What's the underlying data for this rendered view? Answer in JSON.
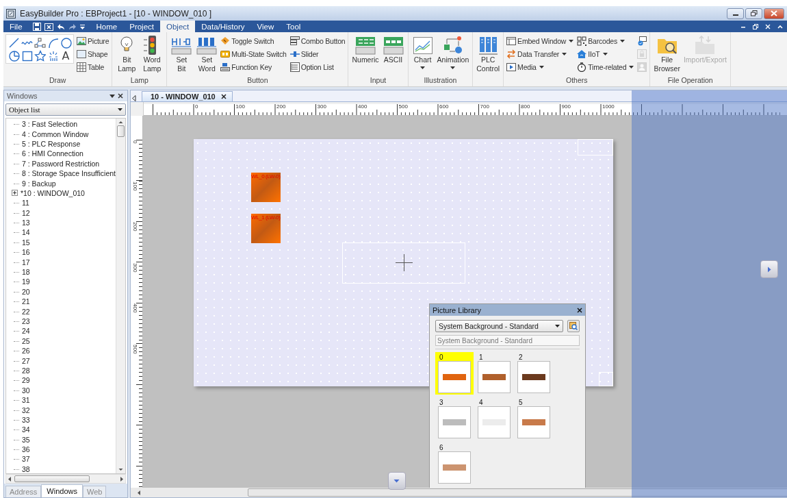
{
  "window": {
    "title": "EasyBuilder Pro : EBProject1 - [10 - WINDOW_010 ]"
  },
  "menu": {
    "file": "File",
    "tabs": [
      {
        "label": "Home",
        "selected": false
      },
      {
        "label": "Project",
        "selected": false
      },
      {
        "label": "Object",
        "selected": true
      },
      {
        "label": "Data/History",
        "selected": false
      },
      {
        "label": "View",
        "selected": false
      },
      {
        "label": "Tool",
        "selected": false
      }
    ]
  },
  "ribbon": {
    "groups": [
      {
        "label": "Draw",
        "items": [
          {
            "kind": "palette",
            "text_tool": "A"
          },
          {
            "kind": "small",
            "label": "Picture",
            "dropdown": false,
            "disabled": false
          },
          {
            "kind": "small",
            "label": "Shape",
            "dropdown": false,
            "disabled": false
          },
          {
            "kind": "small",
            "label": "Table",
            "dropdown": false,
            "disabled": false
          }
        ]
      },
      {
        "label": "Lamp",
        "items": [
          {
            "kind": "large",
            "label": "Bit Lamp",
            "dropdown": false,
            "disabled": false
          },
          {
            "kind": "large",
            "label": "Word Lamp",
            "dropdown": false,
            "disabled": false
          }
        ]
      },
      {
        "label": "Button",
        "items": [
          {
            "kind": "large",
            "label": "Set Bit",
            "dropdown": false,
            "disabled": false
          },
          {
            "kind": "large",
            "label": "Set Word",
            "dropdown": false,
            "disabled": false
          },
          {
            "kind": "small",
            "label": "Toggle Switch",
            "dropdown": false,
            "disabled": false
          },
          {
            "kind": "small",
            "label": "Multi-State Switch",
            "dropdown": false,
            "disabled": false
          },
          {
            "kind": "small",
            "label": "Function Key",
            "dropdown": false,
            "disabled": false
          },
          {
            "kind": "small",
            "label": "Combo Button",
            "dropdown": false,
            "disabled": false
          },
          {
            "kind": "small",
            "label": "Slider",
            "dropdown": false,
            "disabled": false
          },
          {
            "kind": "small",
            "label": "Option List",
            "dropdown": false,
            "disabled": false
          }
        ]
      },
      {
        "label": "Input",
        "items": [
          {
            "kind": "large",
            "label": "Numeric",
            "dropdown": false,
            "disabled": false
          },
          {
            "kind": "large",
            "label": "ASCII",
            "dropdown": false,
            "disabled": false
          }
        ]
      },
      {
        "label": "Illustration",
        "items": [
          {
            "kind": "large",
            "label": "Chart",
            "dropdown": true,
            "disabled": false
          },
          {
            "kind": "large",
            "label": "Animation",
            "dropdown": true,
            "disabled": false
          }
        ]
      },
      {
        "items": [
          {
            "kind": "large",
            "label": "PLC Control",
            "dropdown": false,
            "disabled": false
          }
        ]
      },
      {
        "label": "Others",
        "items": [
          {
            "kind": "small",
            "label": "Embed Window",
            "dropdown": true,
            "disabled": false
          },
          {
            "kind": "small",
            "label": "Data Transfer",
            "dropdown": true,
            "disabled": false
          },
          {
            "kind": "small",
            "label": "Media",
            "dropdown": true,
            "disabled": false
          },
          {
            "kind": "small",
            "label": "Barcodes",
            "dropdown": true,
            "disabled": false
          },
          {
            "kind": "small",
            "label": "IIoT",
            "dropdown": true,
            "disabled": false
          },
          {
            "kind": "small",
            "label": "Time-related",
            "dropdown": true,
            "disabled": false
          },
          {
            "kind": "icon",
            "disabled": false
          },
          {
            "kind": "icon",
            "disabled": true
          },
          {
            "kind": "icon",
            "disabled": true
          }
        ]
      },
      {
        "label": "File Operation",
        "items": [
          {
            "kind": "large",
            "label": "File Browser",
            "dropdown": false,
            "disabled": false
          },
          {
            "kind": "large",
            "label": "Import/Export",
            "dropdown": false,
            "disabled": true
          }
        ]
      }
    ]
  },
  "windows_panel": {
    "title": "Windows",
    "selector": "Object list",
    "items": [
      {
        "label": "3 : Fast Selection",
        "collapsed": false
      },
      {
        "label": "4 : Common Window",
        "collapsed": false
      },
      {
        "label": "5 : PLC Response",
        "collapsed": false
      },
      {
        "label": "6 : HMI Connection",
        "collapsed": false
      },
      {
        "label": "7 : Password Restriction",
        "collapsed": false
      },
      {
        "label": "8 : Storage Space Insufficient",
        "collapsed": false
      },
      {
        "label": "9 : Backup",
        "collapsed": false
      },
      {
        "label": "*10 : WINDOW_010",
        "collapsed": true
      },
      {
        "label": "11",
        "collapsed": false
      },
      {
        "label": "12",
        "collapsed": false
      },
      {
        "label": "13",
        "collapsed": false
      },
      {
        "label": "14",
        "collapsed": false
      },
      {
        "label": "15",
        "collapsed": false
      },
      {
        "label": "16",
        "collapsed": false
      },
      {
        "label": "17",
        "collapsed": false
      },
      {
        "label": "18",
        "collapsed": false
      },
      {
        "label": "19",
        "collapsed": false
      },
      {
        "label": "20",
        "collapsed": false
      },
      {
        "label": "21",
        "collapsed": false
      },
      {
        "label": "22",
        "collapsed": false
      },
      {
        "label": "23",
        "collapsed": false
      },
      {
        "label": "24",
        "collapsed": false
      },
      {
        "label": "25",
        "collapsed": false
      },
      {
        "label": "26",
        "collapsed": false
      },
      {
        "label": "27",
        "collapsed": false
      },
      {
        "label": "28",
        "collapsed": false
      },
      {
        "label": "29",
        "collapsed": false
      },
      {
        "label": "30",
        "collapsed": false
      },
      {
        "label": "31",
        "collapsed": false
      },
      {
        "label": "32",
        "collapsed": false
      },
      {
        "label": "33",
        "collapsed": false
      },
      {
        "label": "34",
        "collapsed": false
      },
      {
        "label": "35",
        "collapsed": false
      },
      {
        "label": "36",
        "collapsed": false
      },
      {
        "label": "37",
        "collapsed": false
      },
      {
        "label": "38",
        "collapsed": false
      }
    ],
    "tabs": [
      {
        "label": "Address",
        "selected": false
      },
      {
        "label": "Windows",
        "selected": true
      },
      {
        "label": "Web",
        "selected": false
      }
    ]
  },
  "document": {
    "tabs": [
      {
        "label": "10 - WINDOW_010",
        "selected": true
      }
    ],
    "ruler": {
      "top_labels": [
        "0",
        "100",
        "200",
        "300",
        "400",
        "500",
        "600",
        "700",
        "800",
        "900",
        "1000"
      ],
      "left_labels": [
        "0",
        "100",
        "200",
        "300",
        "400",
        "500"
      ]
    },
    "objects": [
      {
        "label": "WL_0 (LW-0)"
      },
      {
        "label": "WL_1 (LW-0)"
      }
    ]
  },
  "picture_library": {
    "title": "Picture Library",
    "category": "System Background - Standard",
    "path": "System Background - Standard",
    "items": [
      {
        "label": "0",
        "selected": true,
        "color": "#e0640f"
      },
      {
        "label": "1",
        "selected": false,
        "color": "#b0602c"
      },
      {
        "label": "2",
        "selected": false,
        "color": "#6b3a1e"
      },
      {
        "label": "3",
        "selected": false,
        "color": "#bcbcbc"
      },
      {
        "label": "4",
        "selected": false,
        "color": "#ececec"
      },
      {
        "label": "5",
        "selected": false,
        "color": "#c87a4a"
      },
      {
        "label": "6",
        "selected": false,
        "color": "#cc9470"
      }
    ]
  }
}
